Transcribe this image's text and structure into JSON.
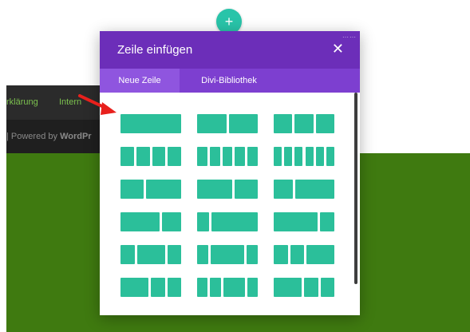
{
  "header": {
    "add_row_symbol": "+"
  },
  "footer": {
    "nav_links": [
      "rklärung",
      "Intern"
    ],
    "powered_prefix": "| Powered by ",
    "powered_brand": "WordPr"
  },
  "modal": {
    "title": "Zeile einfügen",
    "close_symbol": "✕",
    "resize_symbol": "⋯⋯",
    "tabs": [
      {
        "label": "Neue Zeile",
        "active": true
      },
      {
        "label": "Divi-Bibliothek",
        "active": false
      }
    ],
    "layouts": [
      [
        "1"
      ],
      [
        "1",
        "1"
      ],
      [
        "1",
        "1",
        "1"
      ],
      [
        "1",
        "1",
        "1",
        "1"
      ],
      [
        "1",
        "1",
        "1",
        "1",
        "1"
      ],
      [
        "1",
        "1",
        "1",
        "1",
        "1",
        "1"
      ],
      [
        "2",
        "3"
      ],
      [
        "3",
        "2"
      ],
      [
        "1",
        "2"
      ],
      [
        "2",
        "1"
      ],
      [
        "1",
        "4"
      ],
      [
        "3",
        "1"
      ],
      [
        "1",
        "2",
        "1"
      ],
      [
        "1",
        "3",
        "1"
      ],
      [
        "1",
        "1",
        "2"
      ],
      [
        "2",
        "1",
        "1"
      ],
      [
        "1",
        "1",
        "2",
        "1"
      ],
      [
        "2",
        "1",
        "1"
      ]
    ]
  },
  "colors": {
    "modal_header": "#6c2eb9",
    "tabs_bar": "#7d3fd0",
    "column_block": "#2bbf9a",
    "add_button": "#29c4a9",
    "footer_link": "#7cc14f",
    "green_area": "#3f7a10",
    "arrow": "#e8201c"
  },
  "icons": {
    "add": "plus-icon",
    "close": "close-icon",
    "arrow": "red-arrow-annotation"
  }
}
